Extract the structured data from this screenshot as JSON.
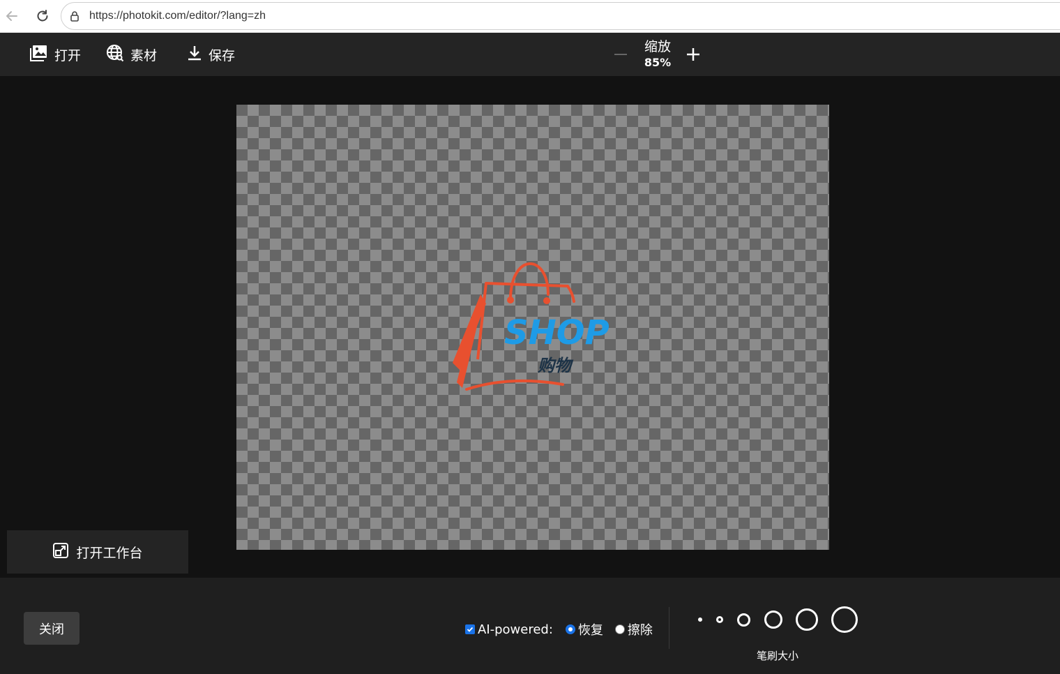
{
  "browser": {
    "url": "https://photokit.com/editor/?lang=zh"
  },
  "toolbar": {
    "open_label": "打开",
    "assets_label": "素材",
    "save_label": "保存",
    "zoom_label": "缩放",
    "zoom_value": "85%"
  },
  "canvas": {
    "logo_text": "SHOP",
    "logo_subtext": "购物",
    "logo_colors": {
      "bag": "#e8502f",
      "shop": "#1e9be6",
      "subtext": "#1d3347"
    }
  },
  "workspace": {
    "workbench_label": "打开工作台"
  },
  "bottom": {
    "close_label": "关闭",
    "ai_label": "AI-powered:",
    "ai_checked": true,
    "restore_label": "恢复",
    "erase_label": "擦除",
    "selected_mode": "恢复",
    "brush_size_label": "笔刷大小"
  },
  "icons": {
    "back": "arrow-left-icon",
    "reload": "reload-icon",
    "lock": "site-info-icon",
    "open": "image-icon",
    "assets": "globe-icon",
    "save": "download-icon",
    "zoom_out": "minus-icon",
    "zoom_in": "plus-icon",
    "workbench": "expand-window-icon"
  }
}
